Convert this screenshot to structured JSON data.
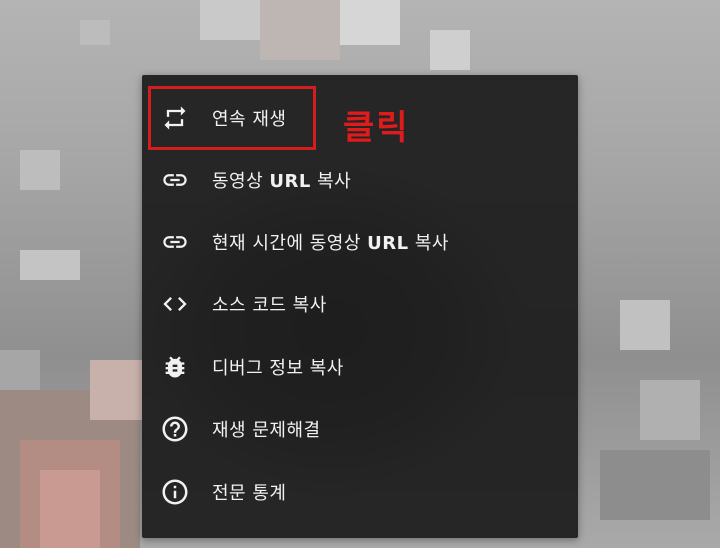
{
  "menu": {
    "items": [
      {
        "icon": "loop-icon",
        "label": "연속 재생"
      },
      {
        "icon": "link-icon",
        "label": "동영상 URL 복사"
      },
      {
        "icon": "link-icon",
        "label": "현재 시간에 동영상 URL 복사"
      },
      {
        "icon": "code-icon",
        "label": "소스 코드 복사"
      },
      {
        "icon": "bug-icon",
        "label": "디버그 정보 복사"
      },
      {
        "icon": "help-icon",
        "label": "재생 문제해결"
      },
      {
        "icon": "info-icon",
        "label": "전문 통계"
      }
    ]
  },
  "annotation": {
    "text": "클릭",
    "color": "#e01b1b"
  }
}
